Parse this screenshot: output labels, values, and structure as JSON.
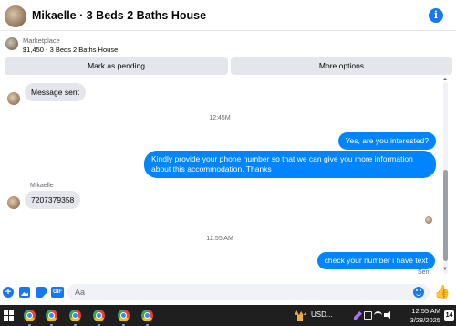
{
  "header": {
    "title": "Mikaelle · 3 Beds 2 Baths House",
    "info_icon": "info-icon",
    "accent": "#1877f2"
  },
  "listing": {
    "label": "Marketplace",
    "price_title": "$1,450 - 3 Beds 2 Baths House",
    "pending_label": "Mark as pending",
    "more_label": "More options"
  },
  "messages": {
    "m1": "Message sent",
    "ts1": "12:45M",
    "out1": "Yes, are you interested?",
    "out2": "Kindly provide your phone number so that we can give you more information about this accommodation. Thanks",
    "sender": "Mikaelle",
    "in2": "7207379358",
    "ts2": "12:55 AM",
    "out3": "check your number i have text",
    "sent_status": "Sent",
    "bubble_out_color": "#0084ff",
    "bubble_in_color": "#e4e6eb"
  },
  "composer": {
    "placeholder": "Aa",
    "icons": [
      "plus-icon",
      "photo-icon",
      "sticker-icon",
      "gif-icon",
      "emoji-icon",
      "like-icon"
    ],
    "gif_label": "GIF"
  },
  "taskbar": {
    "weather": "USD...",
    "time": "12:55 AM",
    "date": "3/28/2025",
    "notifications": "14"
  }
}
